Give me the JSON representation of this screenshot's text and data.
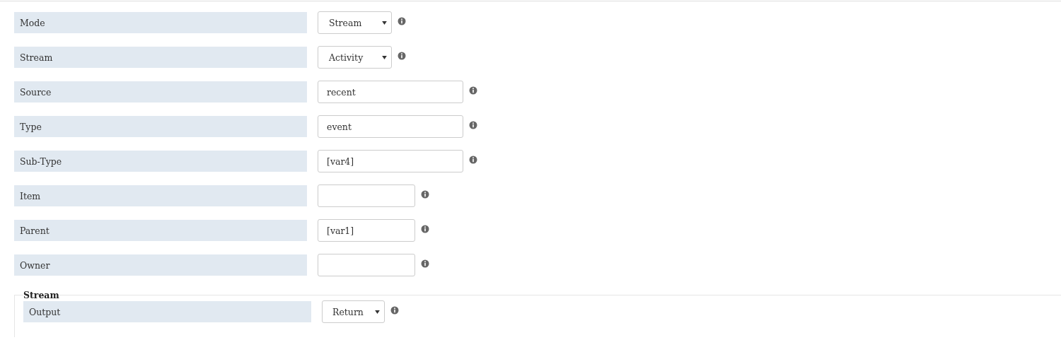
{
  "fields": [
    {
      "label": "Mode",
      "kind": "select",
      "value": "Stream"
    },
    {
      "label": "Stream",
      "kind": "select",
      "value": "Activity"
    },
    {
      "label": "Source",
      "kind": "input",
      "value": "recent"
    },
    {
      "label": "Type",
      "kind": "input",
      "value": "event"
    },
    {
      "label": "Sub-Type",
      "kind": "input",
      "value": "[var4]"
    },
    {
      "label": "Item",
      "kind": "shortinput"
    },
    {
      "label": "Parent",
      "kind": "shortinput",
      "value": "[var1]"
    },
    {
      "label": "Owner",
      "kind": "shortinput"
    }
  ],
  "section": {
    "legend": "Stream",
    "fields": [
      {
        "label": "Output",
        "kind": "select",
        "value": "Return"
      }
    ]
  }
}
